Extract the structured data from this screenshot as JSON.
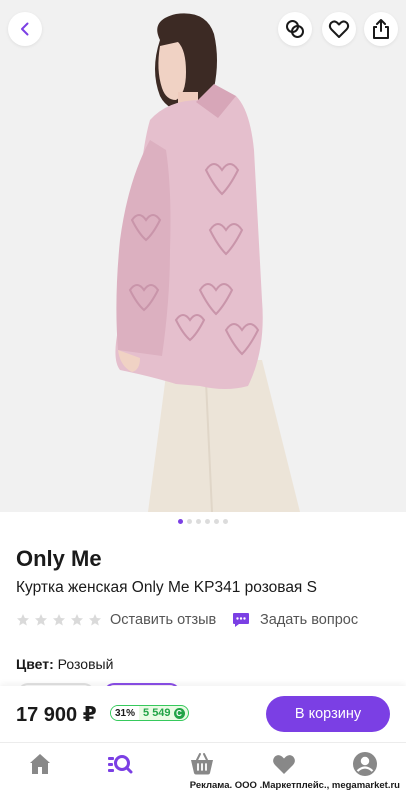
{
  "header": {
    "back_icon": "chevron-left-icon",
    "compare_icon": "compare-circles-icon",
    "favorite_icon": "heart-icon",
    "share_icon": "share-icon"
  },
  "gallery": {
    "total_images": 6,
    "active_index": 0,
    "image_description": "model-in-pink-quilted-jacket"
  },
  "product": {
    "brand": "Only Me",
    "title": "Куртка женская Only Me KP341 розовая S",
    "rating_stars": 0,
    "rating_max": 5,
    "review_link": "Оставить отзыв",
    "ask_question": "Задать вопрос",
    "color_label": "Цвет:",
    "color_value": "Розовый"
  },
  "purchase": {
    "price": "17 900 ₽",
    "bonus_percent": "31%",
    "bonus_amount": "5 549",
    "bonus_coin": "С",
    "cart_button": "В корзину"
  },
  "tabbar": {
    "items": [
      "home-icon",
      "catalog-search-icon",
      "cart-icon",
      "favorites-icon",
      "profile-icon"
    ],
    "active": "catalog-search-icon"
  },
  "ad_note": "Реклама. ООО .Маркетплейс., megamarket.ru",
  "colors": {
    "accent": "#7b3fe4",
    "bonus_green": "#22a447",
    "jacket_pink": "#e5bfcd"
  }
}
